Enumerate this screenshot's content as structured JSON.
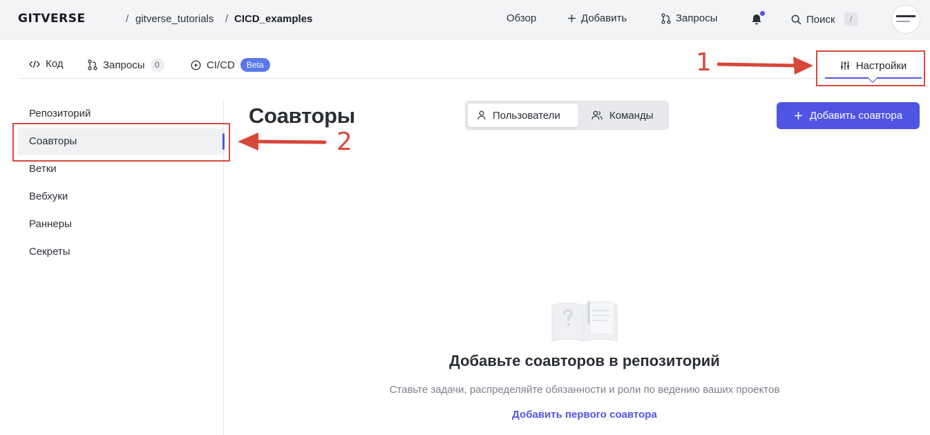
{
  "header": {
    "logo": "GITVERSE",
    "breadcrumb": {
      "separator": "/",
      "owner": "gitverse_tutorials",
      "repo": "CICD_examples"
    },
    "nav": {
      "overview": "Обзор",
      "add": "Добавить",
      "requests": "Запросы",
      "search": "Поиск",
      "search_shortcut": "/"
    },
    "icons": [
      "plus-icon",
      "pull-request-icon",
      "bell-icon",
      "search-icon"
    ],
    "notification_dot_color": "#4f54e3"
  },
  "repo_tabs": {
    "code": "Код",
    "requests": "Запросы",
    "requests_count": "0",
    "cicd": "CI/CD",
    "cicd_badge": "Beta",
    "settings": "Настройки",
    "active": "Настройки",
    "icons": [
      "code-icon",
      "pull-request-icon",
      "play-circle-icon",
      "sliders-icon"
    ]
  },
  "sidebar": {
    "items": [
      {
        "label": "Репозиторий",
        "active": false
      },
      {
        "label": "Соавторы",
        "active": true
      },
      {
        "label": "Ветки",
        "active": false
      },
      {
        "label": "Вебхуки",
        "active": false
      },
      {
        "label": "Раннеры",
        "active": false
      },
      {
        "label": "Секреты",
        "active": false
      }
    ]
  },
  "main": {
    "title": "Соавторы",
    "segmented": {
      "users": "Пользователи",
      "teams": "Команды",
      "active": "Пользователи"
    },
    "add_button": "Добавить соавтора",
    "empty_state": {
      "icon": "open-book-question-icon",
      "title": "Добавьте соавторов в репозиторий",
      "subtitle": "Ставьте задачи, распределяйте обязанности и роли по ведению ваших проектов",
      "link": "Добавить первого соавтора"
    }
  },
  "annotations": {
    "first": "1",
    "second": "2",
    "color": "#d8473a"
  },
  "colors": {
    "accent": "#4f54e3",
    "beta_badge": "#5a78e8",
    "header_bg": "#f3f4f6"
  }
}
